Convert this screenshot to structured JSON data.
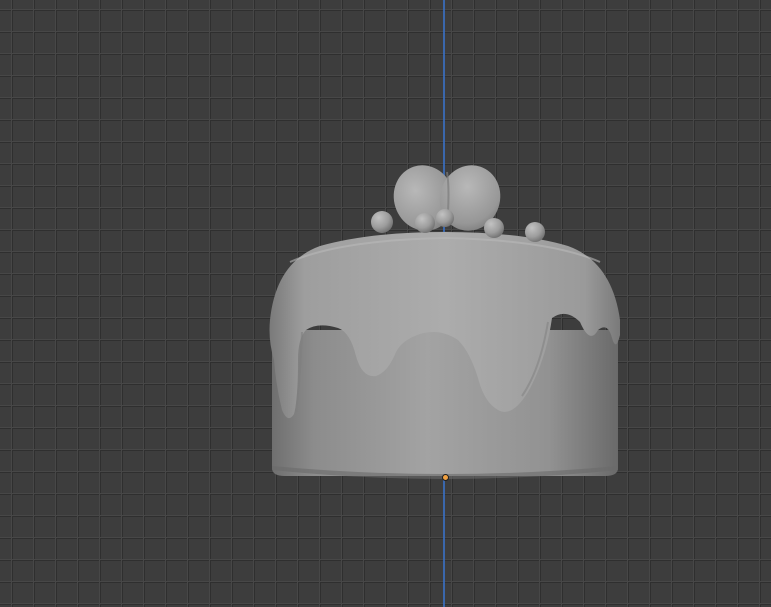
{
  "viewport": {
    "mode": "solid",
    "background_color": "#3d3d3d",
    "grid_color": "#474747",
    "axis_color": "#3a6fc0",
    "origin_color": "#f0a040"
  },
  "scene": {
    "objects": [
      {
        "name": "cake-body",
        "color": "#9a9a9a"
      },
      {
        "name": "icing-drip",
        "color": "#a7a7a7"
      },
      {
        "name": "heart-topper",
        "color": "#9e9e9e"
      },
      {
        "name": "decor-balls",
        "color": "#a2a2a2"
      }
    ]
  }
}
